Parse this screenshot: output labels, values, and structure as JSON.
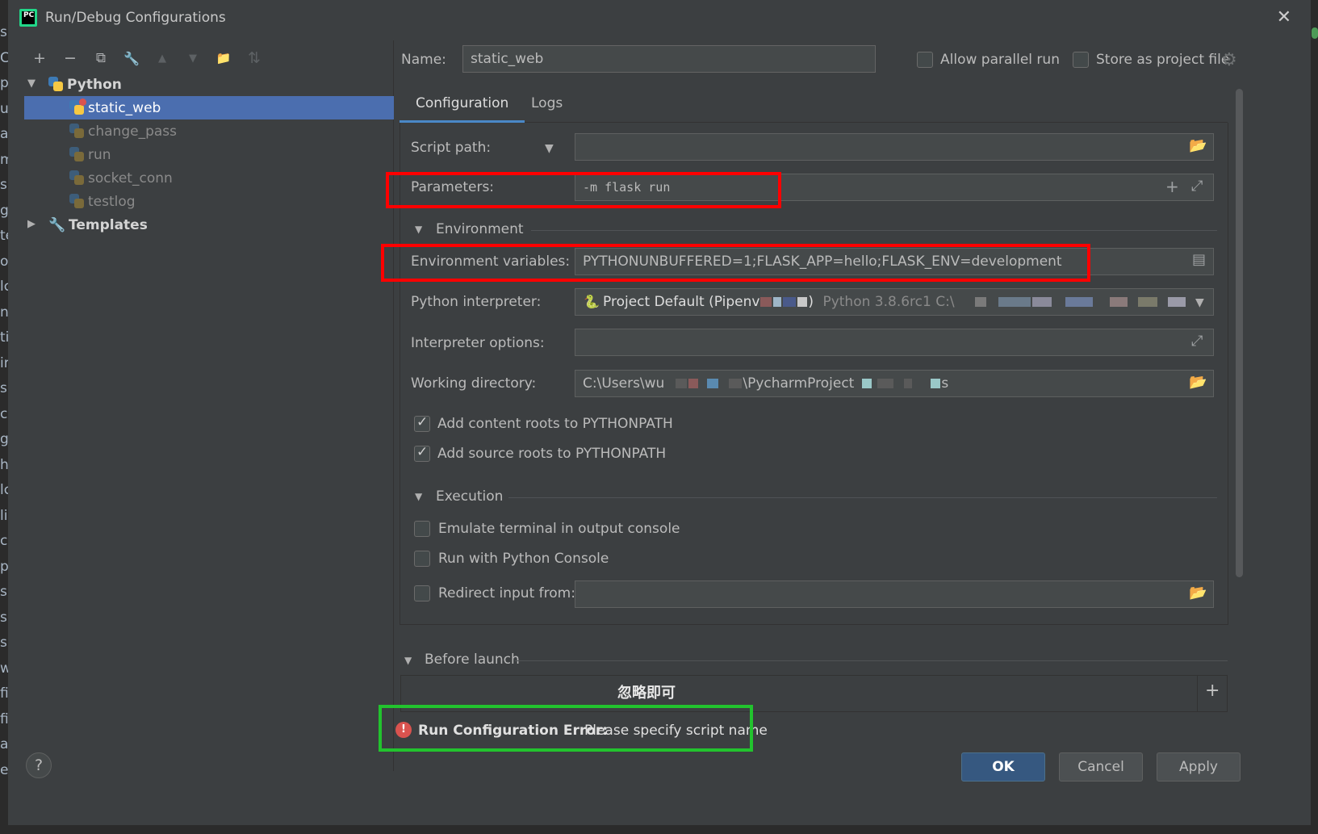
{
  "window": {
    "title": "Run/Debug Configurations",
    "app_icon_text": "PC"
  },
  "left_edge_letters": [
    "s",
    "C",
    "p",
    "ur",
    "a",
    "m",
    "s",
    "g",
    "te",
    "op",
    "lc",
    "n",
    "ti",
    "ir",
    "s",
    "c",
    "g",
    "h",
    "lc",
    "li",
    "c",
    "p",
    "s",
    "s",
    "s",
    "w",
    "fi",
    "fi",
    "al",
    "e"
  ],
  "toolbar": {
    "add": "+",
    "remove": "−",
    "copy": "⧉",
    "edit_defaults": "🔧",
    "move_up": "▲",
    "move_down": "▼",
    "new_folder": "📁",
    "sort": "⇅"
  },
  "tree": {
    "python_group": "Python",
    "items": [
      {
        "label": "static_web",
        "selected": true
      },
      {
        "label": "change_pass",
        "selected": false
      },
      {
        "label": "run",
        "selected": false
      },
      {
        "label": "socket_conn",
        "selected": false
      },
      {
        "label": "testlog",
        "selected": false
      }
    ],
    "templates_group": "Templates"
  },
  "name": {
    "label": "Name:",
    "value": "static_web"
  },
  "options": {
    "allow_parallel": "Allow parallel run",
    "store_as_project": "Store as project file"
  },
  "tabs": {
    "configuration": "Configuration",
    "logs": "Logs"
  },
  "config": {
    "script_path_label": "Script path:",
    "parameters_label": "Parameters:",
    "parameters_value": "-m flask run",
    "environment_header": "Environment",
    "env_vars_label": "Environment variables:",
    "env_vars_value": "PYTHONUNBUFFERED=1;FLASK_APP=hello;FLASK_ENV=development",
    "interpreter_label": "Python interpreter:",
    "interpreter_value": "Project Default (Pipenv",
    "interpreter_close": ")",
    "interpreter_version": "Python 3.8.6rc1 C:\\",
    "interp_options_label": "Interpreter options:",
    "working_dir_label": "Working directory:",
    "working_dir_start": "C:\\Users\\wu",
    "working_dir_mid": "\\PycharmProject",
    "working_dir_end": "s",
    "add_content_roots": "Add content roots to PYTHONPATH",
    "add_source_roots": "Add source roots to PYTHONPATH",
    "execution_header": "Execution",
    "emulate_terminal": "Emulate terminal in output console",
    "run_with_console": "Run with Python Console",
    "redirect_input": "Redirect input from:"
  },
  "before_launch": {
    "header": "Before launch",
    "note": "忽略即可",
    "add": "+"
  },
  "error": {
    "bold": "Run Configuration Error:",
    "message": "Please specify script name",
    "icon": "!"
  },
  "buttons": {
    "help": "?",
    "ok": "OK",
    "cancel": "Cancel",
    "apply": "Apply"
  },
  "colors": {
    "highlight_red": "#ff0000",
    "highlight_green": "#22c32e",
    "selection": "#4b6eaf",
    "tab_underline": "#4a88c7"
  }
}
